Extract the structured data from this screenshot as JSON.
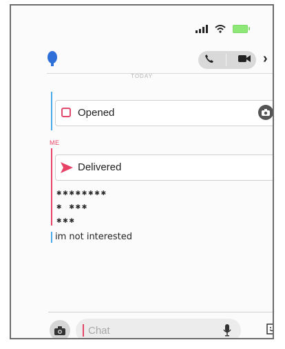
{
  "header": {
    "avatar_icon": "bitmoji-avatar-icon",
    "call_icon": "phone-icon",
    "video_icon": "video-camera-icon",
    "next_icon": "chevron-right-icon"
  },
  "divider_label": "TODAY",
  "messages": {
    "opened_label": "Opened",
    "me_label": "ME",
    "delivered_label": "Delivered",
    "censored_lines": [
      "✱✱✱✱✱✱✱✱",
      "✱ ✱✱✱",
      "✱✱✱"
    ],
    "reply_text": "im not interested"
  },
  "composer": {
    "placeholder": "Chat",
    "camera_icon": "camera-icon",
    "mic_icon": "microphone-icon",
    "sticker_icon": "sticker-icon"
  },
  "colors": {
    "friend_accent": "#4aa8e8",
    "me_accent": "#e54266",
    "battery": "#8de878"
  }
}
